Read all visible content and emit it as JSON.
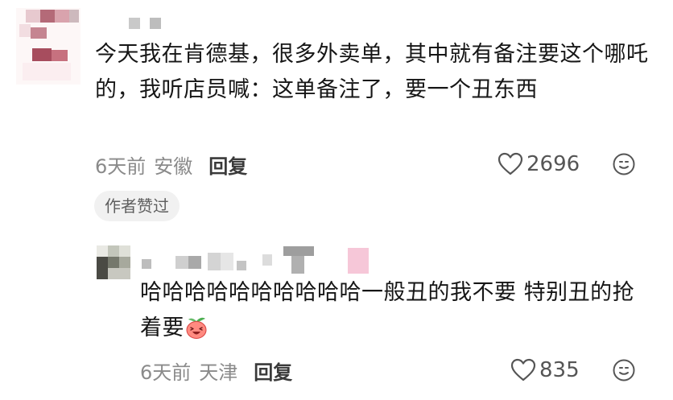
{
  "comment1": {
    "text": "今天我在肯德基，很多外卖单，其中就有备注要这个哪吒的，我听店员喊：这单备注了，要一个丑东西",
    "time": "6天前",
    "location": "安徽",
    "reply_label": "回复",
    "like_count": "2696",
    "author_liked_badge": "作者赞过"
  },
  "reply1": {
    "text": "哈哈哈哈哈哈哈哈哈哈一般丑的我不要 特别丑的抢着要",
    "emoji": "laughing-peach-emoji",
    "time": "6天前",
    "location": "天津",
    "reply_label": "回复",
    "like_count": "835"
  },
  "icons": {
    "like": "heart-outline-icon",
    "emoji_react": "smiley-face-icon"
  }
}
